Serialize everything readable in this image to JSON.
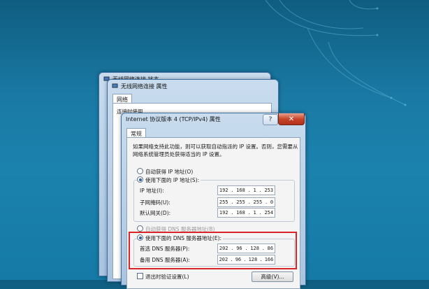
{
  "windows": {
    "status": {
      "title": "无线网络连接 状态"
    },
    "props": {
      "title": "无线网络连接 属性",
      "tab": "网络",
      "connect_using": "连接时使用"
    },
    "ipv4": {
      "title": "Internet 协议版本 4 (TCP/IPv4) 属性",
      "tab": "常规"
    }
  },
  "ipv4_form": {
    "description": "如果网络支持此功能，则可以获取自动指派的 IP 设置。否则，您需要从网络系统管理员处获得适当的 IP 设置。",
    "auto_ip_label": "自动获得 IP 地址(O)",
    "manual_ip_label": "使用下面的 IP 地址(S):",
    "ip_label": "IP 地址(I):",
    "ip_value": [
      "192",
      "168",
      "1",
      "253"
    ],
    "mask_label": "子网掩码(U):",
    "mask_value": [
      "255",
      "255",
      "255",
      "0"
    ],
    "gateway_label": "默认网关(D):",
    "gateway_value": [
      "192",
      "168",
      "1",
      "254"
    ],
    "auto_dns_label": "自动获得 DNS 服务器地址(B)",
    "manual_dns_label": "使用下面的 DNS 服务器地址(E):",
    "pref_dns_label": "首选 DNS 服务器(P):",
    "pref_dns_value": [
      "202",
      "96",
      "128",
      "86"
    ],
    "alt_dns_label": "备用 DNS 服务器(A):",
    "alt_dns_value": [
      "202",
      "96",
      "128",
      "166"
    ],
    "validate_label": "退出时验证设置(L)",
    "advanced_label": "高级(V)..."
  },
  "controls": {
    "help": "?",
    "close": "✕"
  },
  "icons": {
    "network": "network-icon",
    "close": "close-icon",
    "help": "help-icon"
  },
  "colors": {
    "highlight": "#d9242a",
    "desktop": "#1a7aa5"
  }
}
